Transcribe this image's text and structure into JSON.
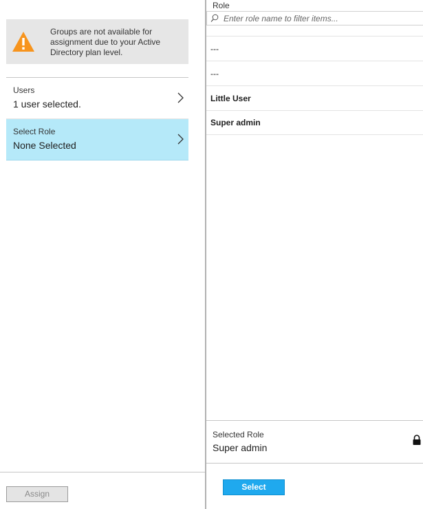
{
  "warning": {
    "text": "Groups are not available for assignment due to your Active Directory plan level."
  },
  "nav": {
    "users_label": "Users",
    "users_value": "1 user selected.",
    "role_label": "Select Role",
    "role_value": "None Selected"
  },
  "left_footer": {
    "assign_label": "Assign"
  },
  "role_panel": {
    "header": "Role",
    "search_placeholder": "Enter role name to filter items...",
    "items": [
      {
        "label": "---"
      },
      {
        "label": "---"
      },
      {
        "label": "Little User"
      },
      {
        "label": "Super admin"
      }
    ],
    "selected_label": "Selected Role",
    "selected_value": "Super admin",
    "select_button": "Select"
  },
  "colors": {
    "selected_row_bg": "#b5e9f9",
    "primary_button": "#1fa9ee",
    "warning_orange": "#f7941d"
  }
}
